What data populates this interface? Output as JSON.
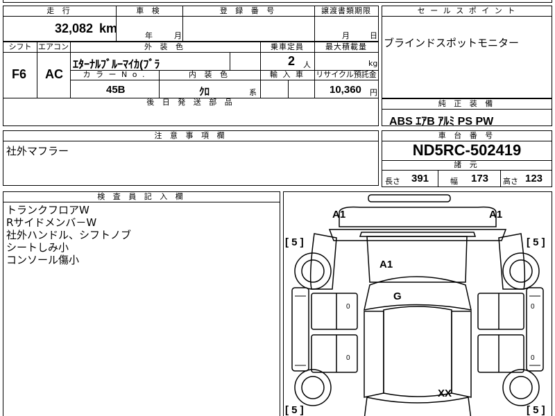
{
  "top": {
    "row1": {
      "mileage_header": "走 行",
      "inspection_header": "車 検",
      "registration_header": "登 録 番 号",
      "transfer_deadline_header": "譲渡書類期限",
      "sales_point_header": "セ ー ル ス ポ イ ン ト",
      "mileage_value": "32,082",
      "mileage_unit": "km",
      "inspection_year": "年",
      "inspection_month": "月",
      "transfer_month": "月",
      "transfer_day": "日",
      "sales_point_text": "ブラインドスポットモニター"
    },
    "row2": {
      "shift_header": "シフト",
      "ac_header": "エアコン",
      "exterior_color_header": "外 装 色",
      "capacity_header": "乗車定員",
      "max_load_header": "最大積載量",
      "shift_value": "F6",
      "ac_value": "AC",
      "exterior_color_value": "ｴﾀｰﾅﾙﾌﾞﾙｰﾏｲｶ(ﾌﾞﾗ",
      "capacity_value": "2",
      "capacity_unit": "人",
      "load_unit": "kg",
      "color_no_header": "カ ラ ー  N o .",
      "interior_color_header": "内 装 色",
      "import_header": "輸 入 車",
      "recycle_header": "リサイクル預託金",
      "color_no_value": "45B",
      "interior_color_value": "ｸﾛ",
      "interior_color_suffix": "系",
      "recycle_value": "10,360",
      "recycle_unit": "円"
    },
    "later_parts_header": "後 日 発 送 部 品"
  },
  "genuine_equipment": {
    "header": "純 正 装 備",
    "value": "ABS ｴｱB ｱﾙﾐ PS PW"
  },
  "notes": {
    "header": "注 意 事 項 欄",
    "text": "社外マフラー"
  },
  "chassis": {
    "header": "車 台 番 号",
    "value": "ND5RC-502419",
    "specs_header": "諸 元",
    "length_label": "長さ",
    "length_value": "391",
    "width_label": "幅",
    "width_value": "173",
    "height_label": "高さ",
    "height_value": "123"
  },
  "inspector": {
    "header": "検 査 員 記 入 欄",
    "lines": [
      "トランクフロアW",
      "Rサイドメンバ－W",
      "社外ハンドル、シフトノブ",
      "シートしみ小",
      "コンソール傷小"
    ]
  },
  "diagram": {
    "marks": {
      "front_left": "A1",
      "front_right": "A1",
      "hood": "A1",
      "windshield": "G",
      "trunk": "XX"
    },
    "tire_left_top": "[ 5 ]",
    "tire_right_top": "[ 5 ]",
    "tire_left_bottom": "[ 5 ]",
    "tire_right_bottom": "[ 5 ]",
    "door_marks": [
      "0",
      "0",
      "0",
      "0"
    ]
  }
}
